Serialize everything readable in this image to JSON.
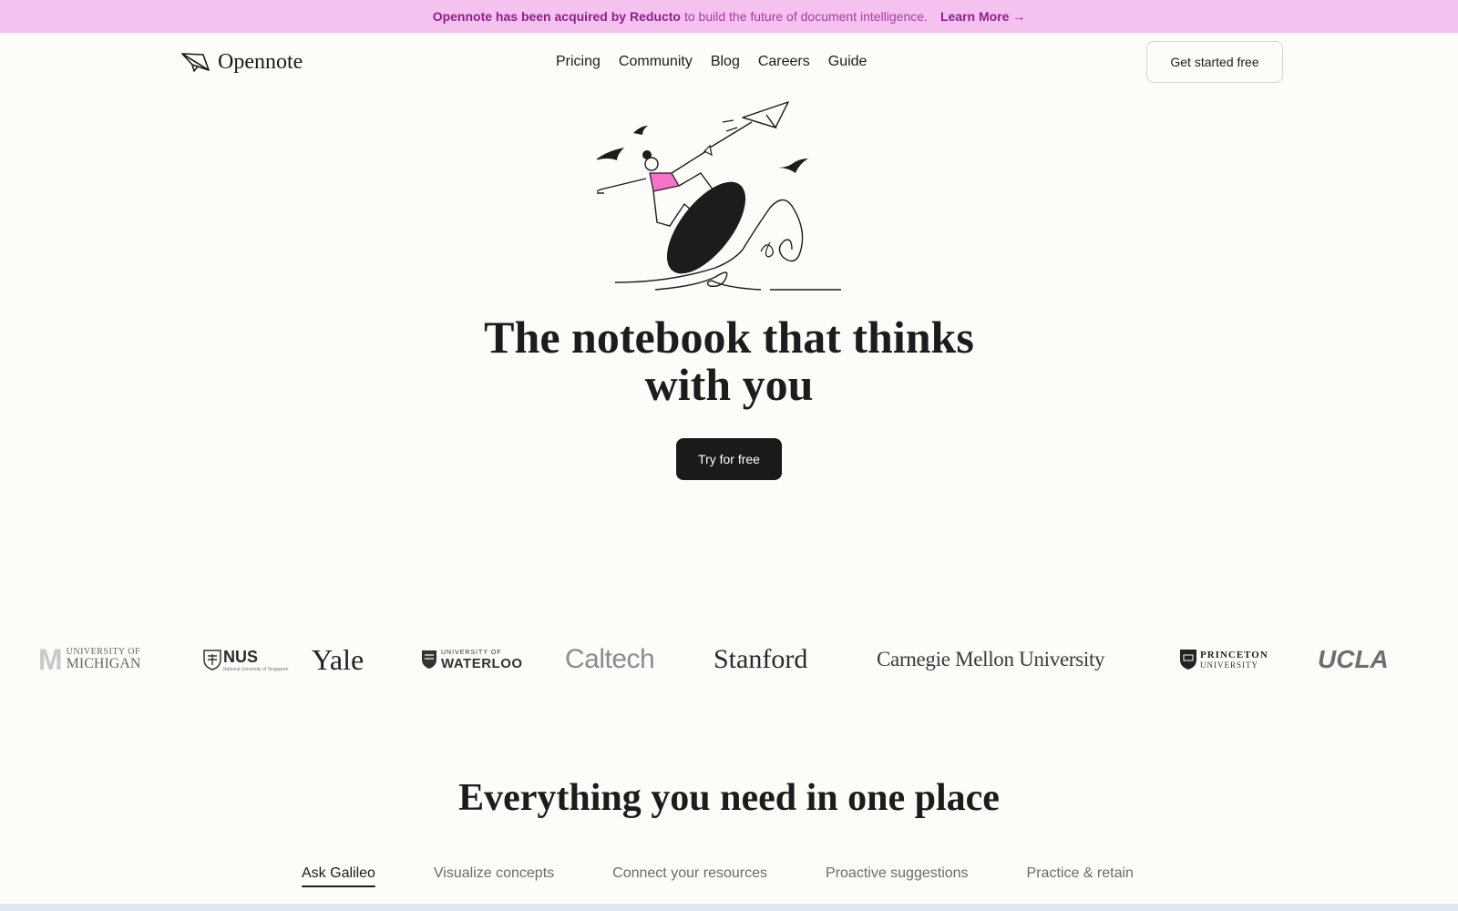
{
  "banner": {
    "strong": "Opennote has been acquired by Reducto",
    "rest": "to build the future of document intelligence.",
    "learn_more": "Learn More →"
  },
  "header": {
    "logo_text": "Opennote",
    "nav": [
      "Pricing",
      "Community",
      "Blog",
      "Careers",
      "Guide"
    ],
    "cta": "Get started free"
  },
  "hero": {
    "title_line1": "The notebook that thinks",
    "title_line2": "with you",
    "cta": "Try for free",
    "illustration_icon": "paper-plane-surfer-illustration",
    "accent_color": "#f472c8"
  },
  "logos": {
    "michigan": {
      "mark": "M",
      "line1": "UNIVERSITY OF",
      "line2": "MICHIGAN"
    },
    "nus": {
      "name": "NUS",
      "sub": "National University of Singapore"
    },
    "yale": "Yale",
    "waterloo": {
      "line1": "UNIVERSITY OF",
      "line2": "WATERLOO"
    },
    "caltech": "Caltech",
    "stanford": "Stanford",
    "cmu": "Carnegie Mellon University",
    "princeton": {
      "line1": "PRINCETON",
      "line2": "UNIVERSITY"
    },
    "ucla": "UCLA"
  },
  "features": {
    "title": "Everything you need in one place",
    "tabs": [
      "Ask Galileo",
      "Visualize concepts",
      "Connect your resources",
      "Proactive suggestions",
      "Practice & retain"
    ],
    "active_tab": "Ask Galileo"
  },
  "colors": {
    "banner_bg": "#f5c2f0",
    "banner_text": "#8e1f8c",
    "page_bg": "#fdfcf8",
    "primary_button": "#1a1a1a"
  }
}
